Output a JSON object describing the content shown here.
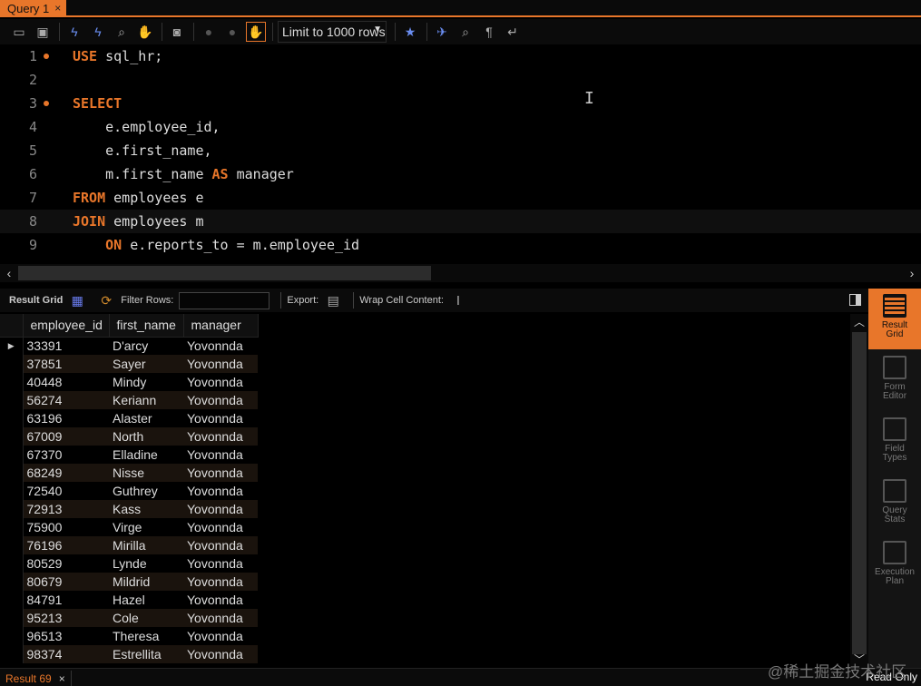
{
  "tabs": [
    {
      "label": "Query 1",
      "close": "×"
    }
  ],
  "toolbar": {
    "limit_label": "Limit to 1000 rows",
    "icons": [
      "open-folder-icon",
      "save-icon",
      "execute-icon",
      "execute-current-icon",
      "explain-icon",
      "stop-icon",
      "toggle-autocommit-icon",
      "commit-icon",
      "rollback-icon",
      "toggle-stop-on-error-icon",
      "add-favorite-icon",
      "beautify-icon",
      "find-icon",
      "invisible-chars-icon",
      "wrap-icon"
    ]
  },
  "editor": {
    "lines": [
      {
        "n": "1",
        "marker": true,
        "tokens": [
          {
            "t": "USE",
            "kw": true
          },
          {
            "t": " sql_hr;",
            "kw": false
          }
        ]
      },
      {
        "n": "2",
        "marker": false,
        "tokens": []
      },
      {
        "n": "3",
        "marker": true,
        "tokens": [
          {
            "t": "SELECT",
            "kw": true
          }
        ]
      },
      {
        "n": "4",
        "marker": false,
        "tokens": [
          {
            "t": "    e.employee_id,",
            "kw": false
          }
        ]
      },
      {
        "n": "5",
        "marker": false,
        "tokens": [
          {
            "t": "    e.first_name,",
            "kw": false
          }
        ]
      },
      {
        "n": "6",
        "marker": false,
        "tokens": [
          {
            "t": "    m.first_name ",
            "kw": false
          },
          {
            "t": "AS",
            "kw": true
          },
          {
            "t": " manager",
            "kw": false
          }
        ]
      },
      {
        "n": "7",
        "marker": false,
        "tokens": [
          {
            "t": "FROM",
            "kw": true
          },
          {
            "t": " employees e",
            "kw": false
          }
        ]
      },
      {
        "n": "8",
        "marker": false,
        "current": true,
        "tokens": [
          {
            "t": "JOIN",
            "kw": true
          },
          {
            "t": " employees m",
            "kw": false
          }
        ]
      },
      {
        "n": "9",
        "marker": false,
        "tokens": [
          {
            "t": "    ",
            "kw": false
          },
          {
            "t": "ON",
            "kw": true
          },
          {
            "t": " e.reports_to = m.employee_id",
            "kw": false
          }
        ]
      }
    ]
  },
  "results_toolbar": {
    "result_grid_label": "Result Grid",
    "filter_label": "Filter Rows:",
    "export_label": "Export:",
    "wrap_label": "Wrap Cell Content:"
  },
  "grid": {
    "columns": [
      "employee_id",
      "first_name",
      "manager"
    ],
    "rows": [
      [
        "33391",
        "D'arcy",
        "Yovonnda"
      ],
      [
        "37851",
        "Sayer",
        "Yovonnda"
      ],
      [
        "40448",
        "Mindy",
        "Yovonnda"
      ],
      [
        "56274",
        "Keriann",
        "Yovonnda"
      ],
      [
        "63196",
        "Alaster",
        "Yovonnda"
      ],
      [
        "67009",
        "North",
        "Yovonnda"
      ],
      [
        "67370",
        "Elladine",
        "Yovonnda"
      ],
      [
        "68249",
        "Nisse",
        "Yovonnda"
      ],
      [
        "72540",
        "Guthrey",
        "Yovonnda"
      ],
      [
        "72913",
        "Kass",
        "Yovonnda"
      ],
      [
        "75900",
        "Virge",
        "Yovonnda"
      ],
      [
        "76196",
        "Mirilla",
        "Yovonnda"
      ],
      [
        "80529",
        "Lynde",
        "Yovonnda"
      ],
      [
        "80679",
        "Mildrid",
        "Yovonnda"
      ],
      [
        "84791",
        "Hazel",
        "Yovonnda"
      ],
      [
        "95213",
        "Cole",
        "Yovonnda"
      ],
      [
        "96513",
        "Theresa",
        "Yovonnda"
      ],
      [
        "98374",
        "Estrellita",
        "Yovonnda"
      ]
    ]
  },
  "sidepanel": [
    {
      "label1": "Result",
      "label2": "Grid",
      "active": true
    },
    {
      "label1": "Form",
      "label2": "Editor",
      "active": false
    },
    {
      "label1": "Field",
      "label2": "Types",
      "active": false
    },
    {
      "label1": "Query",
      "label2": "Stats",
      "active": false
    },
    {
      "label1": "Execution",
      "label2": "Plan",
      "active": false
    }
  ],
  "statusbar": {
    "result_tab": "Result 69",
    "close": "×",
    "readonly": "Read Only",
    "watermark": "@稀土掘金技术社区"
  },
  "colors": {
    "accent": "#e8762a",
    "background": "#000000"
  }
}
